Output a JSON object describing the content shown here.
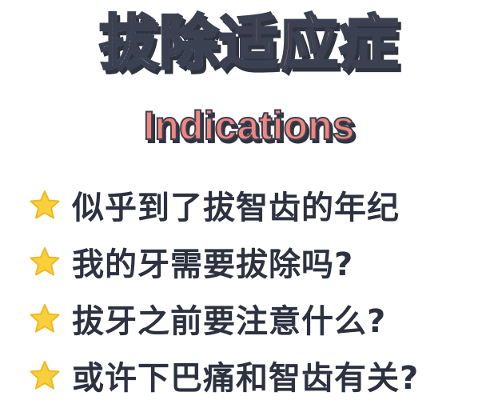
{
  "title": {
    "part1": "拔除",
    "part2": "适应症"
  },
  "subtitle": "Indications",
  "items": [
    {
      "icon": "star-icon",
      "text": "似乎到了拔智齿的年纪"
    },
    {
      "icon": "star-icon",
      "text": "我的牙需要拔除吗?"
    },
    {
      "icon": "star-icon",
      "text": "拔牙之前要注意什么?"
    },
    {
      "icon": "star-icon",
      "text": "或许下巴痛和智齿有关?"
    }
  ],
  "colors": {
    "title_dark": "#5a6475",
    "title_pink": "#f28b8b",
    "subtitle": "#f0867f",
    "outline": "#3b4150",
    "star": "#f9d03c",
    "text": "#2d3140"
  }
}
